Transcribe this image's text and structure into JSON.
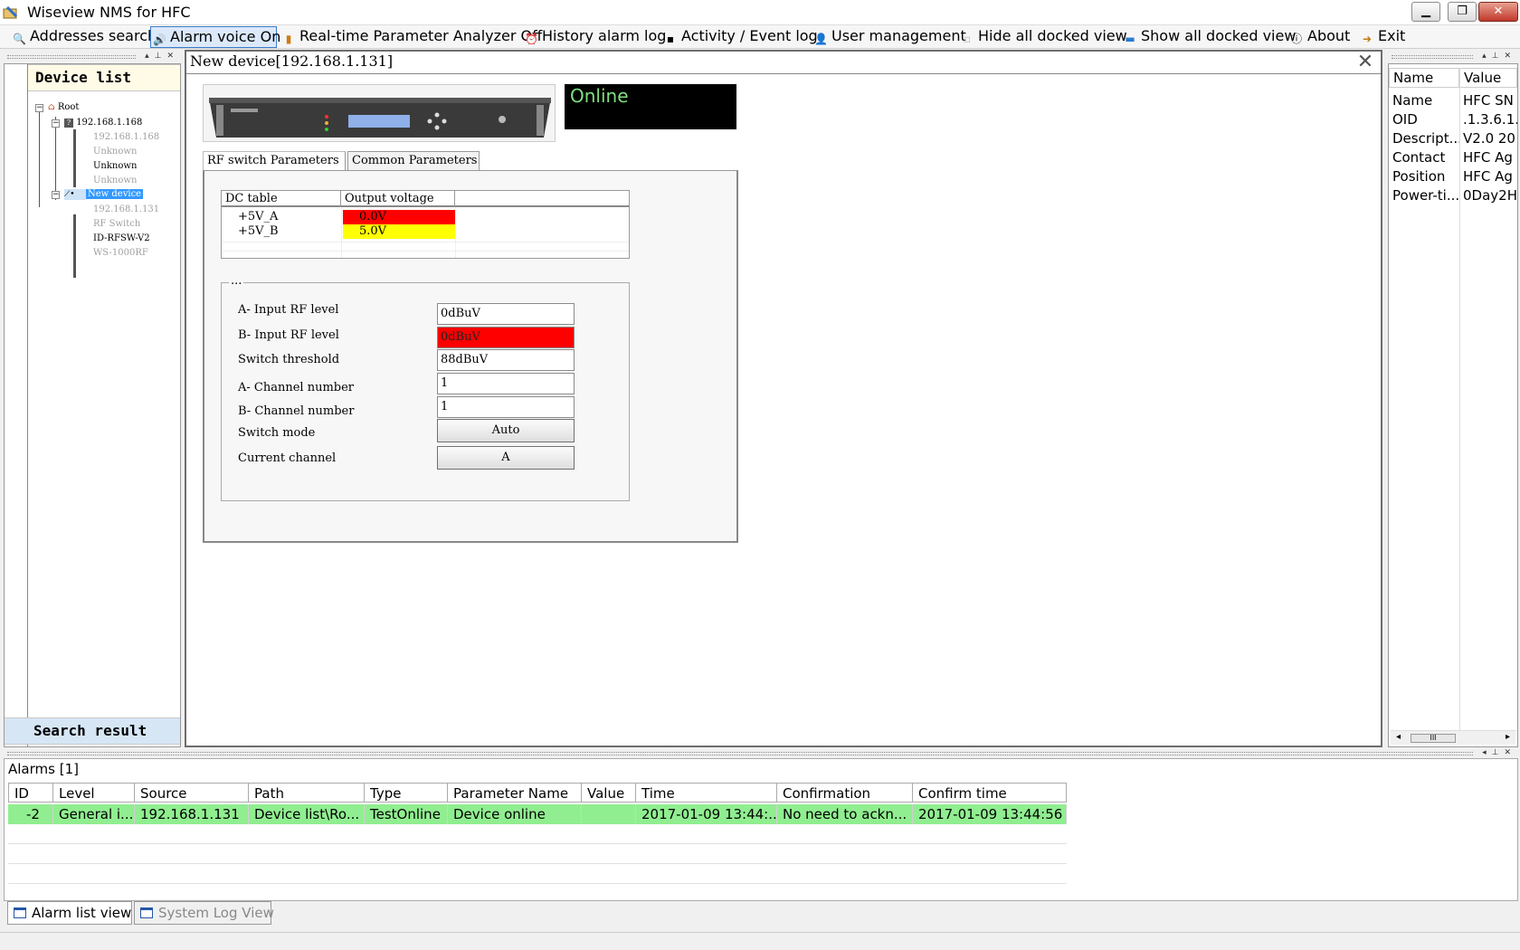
{
  "window": {
    "title": "Wiseview NMS for HFC",
    "minimize": "▁",
    "maximize": "❐",
    "close": "✕"
  },
  "toolbar": {
    "addresses_search": "Addresses search",
    "alarm_voice": "Alarm voice On",
    "rt_analyzer": "Real-time Parameter Analyzer Off",
    "history_alarm": "History alarm log",
    "activity_log": "Activity / Event log",
    "user_mgmt": "User management",
    "hide_docked": "Hide all docked view",
    "show_docked": "Show all docked view",
    "about": "About",
    "exit": "Exit"
  },
  "device_list": {
    "title": "Device list",
    "search_result": "Search result",
    "tree": [
      {
        "label": "Root"
      },
      {
        "label": "192.168.1.168"
      },
      {
        "label": "192.168.1.168"
      },
      {
        "label": "Unknown"
      },
      {
        "label": "Unknown"
      },
      {
        "label": "Unknown"
      },
      {
        "label": "New device"
      },
      {
        "label": "192.168.1.131"
      },
      {
        "label": "RF Switch"
      },
      {
        "label": "ID-RFSW-V2"
      },
      {
        "label": "WS-1000RF"
      }
    ]
  },
  "document": {
    "title": "New device[192.168.1.131]",
    "status": "Online",
    "tabs": [
      "RF switch Parameters",
      "Common Parameters"
    ],
    "dc_table": {
      "headers": [
        "DC table",
        "Output voltage"
      ],
      "rows": [
        {
          "name": "+5V_A",
          "value": "0.0V",
          "color": "#ff0000"
        },
        {
          "name": "+5V_B",
          "value": "5.0V",
          "color": "#ffff00"
        }
      ]
    },
    "group_legend": "...",
    "params": {
      "a_input_label": "A- Input RF level",
      "a_input_value": "0dBuV",
      "b_input_label": "B- Input RF level",
      "b_input_value": "0dBuV",
      "threshold_label": "Switch threshold",
      "threshold_value": "88dBuV",
      "a_channel_label": "A- Channel number",
      "a_channel_value": "1",
      "b_channel_label": "B- Channel number",
      "b_channel_value": "1",
      "switch_mode_label": "Switch mode",
      "switch_mode_value": "Auto",
      "current_channel_label": "Current channel",
      "current_channel_value": "A"
    }
  },
  "properties": {
    "headers": [
      "Name",
      "Value"
    ],
    "rows": [
      {
        "k": "Name",
        "v": "HFC SN"
      },
      {
        "k": "OID",
        "v": ".1.3.6.1."
      },
      {
        "k": "Descript...",
        "v": "V2.0 20"
      },
      {
        "k": "Contact",
        "v": "HFC Ag"
      },
      {
        "k": "Position",
        "v": "HFC Ag"
      },
      {
        "k": "Power-ti...",
        "v": "0Day2H"
      }
    ],
    "scroll_thumb": "III"
  },
  "alarms": {
    "title": "Alarms [1]",
    "headers": [
      "ID",
      "Level",
      "Source",
      "Path",
      "Type",
      "Parameter Name",
      "Value",
      "Time",
      "Confirmation",
      "Confirm time"
    ],
    "rows": [
      [
        "-2",
        "General i...",
        "192.168.1.131",
        "Device list\\Ro...",
        "TestOnline",
        "Device online",
        "",
        "2017-01-09 13:44:...",
        "No need to ackn...",
        "2017-01-09 13:44:56"
      ]
    ]
  },
  "bottom_tabs": [
    "Alarm list view",
    "System Log View"
  ],
  "colors": {
    "online_text": "#7fe07f",
    "alarm_row": "#90ee90",
    "selection": "#3399ff",
    "error_field": "#ff0000"
  }
}
